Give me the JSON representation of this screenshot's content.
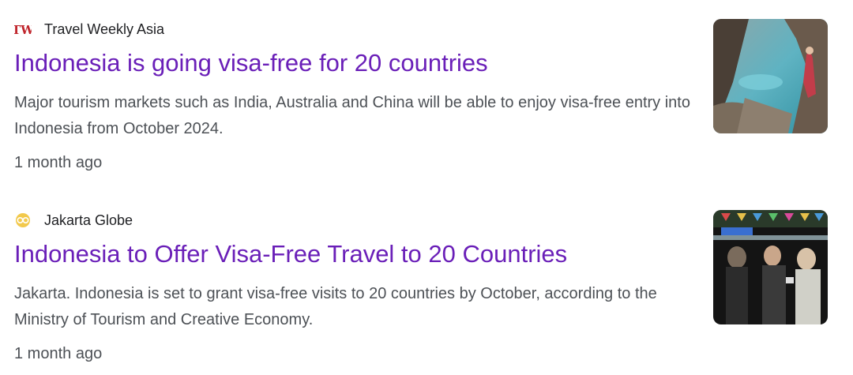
{
  "results": [
    {
      "source": "Travel Weekly Asia",
      "favicon_text": "TW",
      "favicon_icon": "travel-weekly-logo-icon",
      "title": "Indonesia is going visa-free for 20 countries",
      "snippet": "Major tourism markets such as India, Australia and China will be able to enjoy visa-free entry into Indonesia from October 2024.",
      "time": "1 month ago",
      "thumbnail_icon": "coastal-cliff-photo"
    },
    {
      "source": "Jakarta Globe",
      "favicon_icon": "jakarta-globe-logo-icon",
      "title": "Indonesia to Offer Visa-Free Travel to 20 Countries",
      "snippet": "Jakarta. Indonesia is set to grant visa-free visits to 20 countries by October, according to the Ministry of Tourism and Creative Economy.",
      "time": "1 month ago",
      "thumbnail_icon": "night-market-crowd-photo"
    }
  ],
  "colors": {
    "title_link": "#6a1fb8",
    "snippet_text": "#4d5156",
    "source_text": "#202124",
    "tw_logo": "#c0262d",
    "jg_logo": "#f2c94c"
  }
}
